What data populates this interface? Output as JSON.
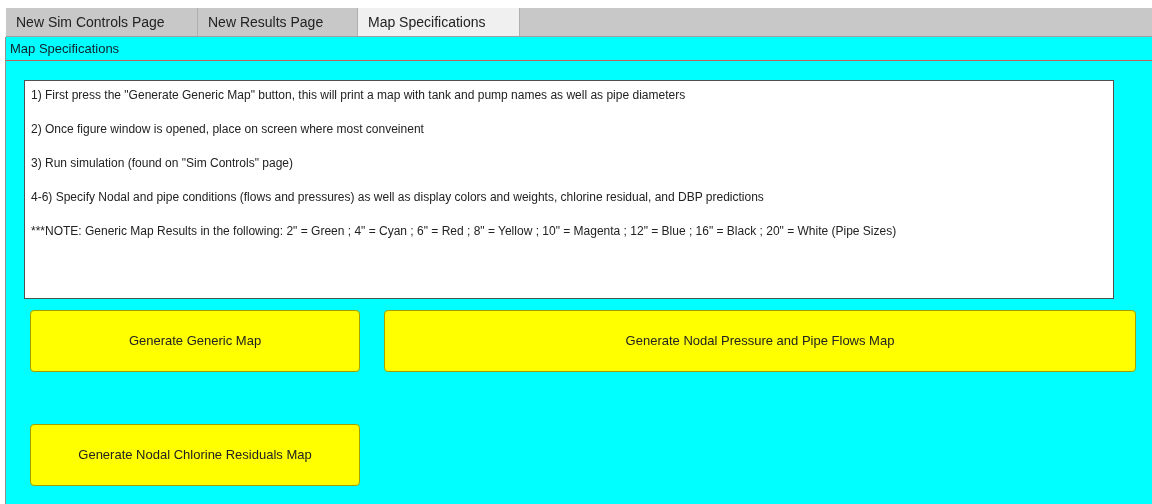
{
  "tabs": [
    {
      "label": "New Sim Controls Page",
      "selected": false
    },
    {
      "label": "New Results Page",
      "selected": false
    },
    {
      "label": "Map Specifications",
      "selected": true
    }
  ],
  "panel": {
    "title": "Map Specifications",
    "instructions": [
      "1) First press the \"Generate Generic Map\" button, this will print a map with tank and pump names as well as pipe diameters",
      "2) Once figure window is opened, place on screen where most conveinent",
      "3) Run simulation (found on \"Sim Controls\" page)",
      "4-6) Specify Nodal and pipe conditions (flows and pressures) as well as display colors and weights, chlorine residual, and DBP predictions",
      "***NOTE: Generic Map Results in the following: 2\" = Green ; 4\" = Cyan ; 6\" = Red ; 8\" = Yellow ; 10\" = Magenta ; 12\" = Blue ; 16\" = Black ; 20\" = White (Pipe Sizes)"
    ],
    "buttons": [
      "Generate Generic Map",
      "Generate Nodal Pressure and Pipe Flows Map",
      "Generate Nodal Chlorine Residuals Map"
    ]
  }
}
